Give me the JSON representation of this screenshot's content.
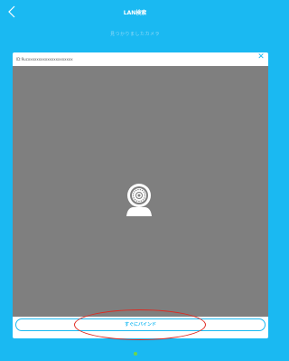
{
  "header": {
    "back_icon": "chevron-left-icon",
    "title": "LAN検索",
    "subtitle": "見つかりましたカメラ"
  },
  "device_card": {
    "device_id": "ID:9ucxxxxxxxxxxxxxxxxxxxxx",
    "close_icon": "close-icon",
    "preview_icon": "webcam-icon",
    "bind_label": "すぐにバインド"
  },
  "colors": {
    "accent": "#1ab9f2",
    "preview_bg": "#7f7f7f",
    "highlight": "#e0281f",
    "indicator": "#6fd64a"
  }
}
